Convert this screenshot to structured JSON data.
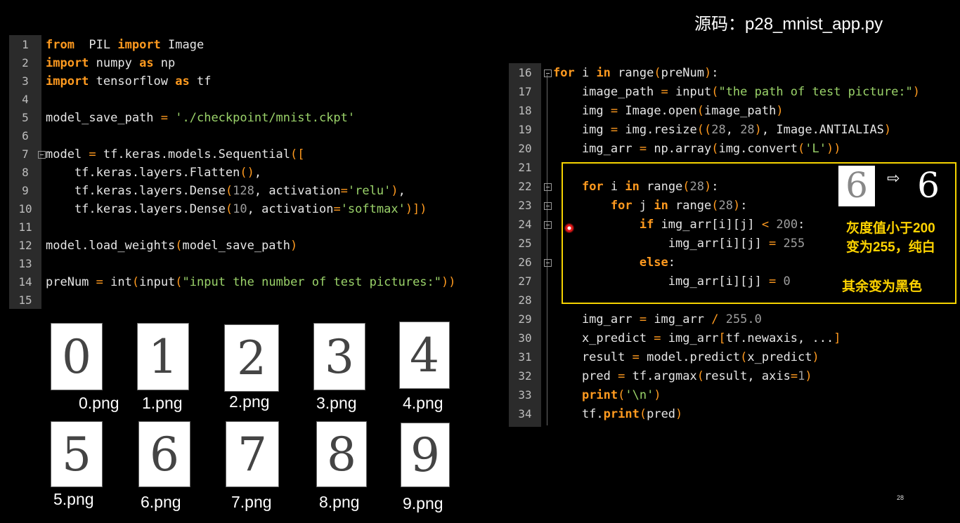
{
  "title": "源码：p28_mnist_app.py",
  "left_code": {
    "lines": [
      {
        "n": "1",
        "tokens": [
          [
            "kw",
            "from"
          ],
          [
            "",
            "  PIL "
          ],
          [
            "kw",
            "import"
          ],
          [
            "",
            " Image"
          ]
        ]
      },
      {
        "n": "2",
        "tokens": [
          [
            "kw",
            "import"
          ],
          [
            "",
            " numpy "
          ],
          [
            "kw",
            "as"
          ],
          [
            "",
            " np"
          ]
        ]
      },
      {
        "n": "3",
        "tokens": [
          [
            "kw",
            "import"
          ],
          [
            "",
            " tensorflow "
          ],
          [
            "kw",
            "as"
          ],
          [
            "",
            " tf"
          ]
        ]
      },
      {
        "n": "4",
        "tokens": []
      },
      {
        "n": "5",
        "tokens": [
          [
            "",
            "model_save_path "
          ],
          [
            "pu",
            "="
          ],
          [
            "",
            " "
          ],
          [
            "st",
            "'./checkpoint/mnist.ckpt'"
          ]
        ]
      },
      {
        "n": "6",
        "tokens": []
      },
      {
        "n": "7",
        "tokens": [
          [
            "",
            "model "
          ],
          [
            "pu",
            "="
          ],
          [
            "",
            " tf.keras.models.Sequential"
          ],
          [
            "pu",
            "(["
          ]
        ]
      },
      {
        "n": "8",
        "tokens": [
          [
            "",
            "    tf.keras.layers.Flatten"
          ],
          [
            "pu",
            "()"
          ],
          [
            "",
            ","
          ]
        ]
      },
      {
        "n": "9",
        "tokens": [
          [
            "",
            "    tf.keras.layers.Dense"
          ],
          [
            "pu",
            "("
          ],
          [
            "nu",
            "128"
          ],
          [
            "",
            ", activation"
          ],
          [
            "pu",
            "="
          ],
          [
            "st",
            "'relu'"
          ],
          [
            "pu",
            ")"
          ],
          [
            "",
            ","
          ]
        ]
      },
      {
        "n": "10",
        "tokens": [
          [
            "",
            "    tf.keras.layers.Dense"
          ],
          [
            "pu",
            "("
          ],
          [
            "nu",
            "10"
          ],
          [
            "",
            ", activation"
          ],
          [
            "pu",
            "="
          ],
          [
            "st",
            "'softmax'"
          ],
          [
            "pu",
            ")])"
          ]
        ]
      },
      {
        "n": "11",
        "tokens": []
      },
      {
        "n": "12",
        "tokens": [
          [
            "",
            "model.load_weights"
          ],
          [
            "pu",
            "("
          ],
          [
            "",
            "model_save_path"
          ],
          [
            "pu",
            ")"
          ]
        ]
      },
      {
        "n": "13",
        "tokens": []
      },
      {
        "n": "14",
        "tokens": [
          [
            "",
            "preNum "
          ],
          [
            "pu",
            "="
          ],
          [
            "",
            " int"
          ],
          [
            "pu",
            "("
          ],
          [
            "",
            "input"
          ],
          [
            "pu",
            "("
          ],
          [
            "st",
            "\"input the number of test pictures:\""
          ],
          [
            "pu",
            "))"
          ]
        ]
      },
      {
        "n": "15",
        "tokens": []
      }
    ]
  },
  "right_code": {
    "lines": [
      {
        "n": "16",
        "tokens": [
          [
            "kw",
            "for"
          ],
          [
            "",
            " i "
          ],
          [
            "kw",
            "in"
          ],
          [
            "",
            " range"
          ],
          [
            "pu",
            "("
          ],
          [
            "",
            "preNum"
          ],
          [
            "pu",
            ")"
          ],
          [
            "",
            ":"
          ]
        ]
      },
      {
        "n": "17",
        "tokens": [
          [
            "",
            "    image_path "
          ],
          [
            "pu",
            "="
          ],
          [
            "",
            " input"
          ],
          [
            "pu",
            "("
          ],
          [
            "st",
            "\"the path of test picture:\""
          ],
          [
            "pu",
            ")"
          ]
        ]
      },
      {
        "n": "18",
        "tokens": [
          [
            "",
            "    img "
          ],
          [
            "pu",
            "="
          ],
          [
            "",
            " Image.open"
          ],
          [
            "pu",
            "("
          ],
          [
            "",
            "image_path"
          ],
          [
            "pu",
            ")"
          ]
        ]
      },
      {
        "n": "19",
        "tokens": [
          [
            "",
            "    img "
          ],
          [
            "pu",
            "="
          ],
          [
            "",
            " img.resize"
          ],
          [
            "pu",
            "(("
          ],
          [
            "nu",
            "28"
          ],
          [
            "",
            ", "
          ],
          [
            "nu",
            "28"
          ],
          [
            "pu",
            ")"
          ],
          [
            "",
            ", Image.ANTIALIAS"
          ],
          [
            "pu",
            ")"
          ]
        ]
      },
      {
        "n": "20",
        "tokens": [
          [
            "",
            "    img_arr "
          ],
          [
            "pu",
            "="
          ],
          [
            "",
            " np.array"
          ],
          [
            "pu",
            "("
          ],
          [
            "",
            "img.convert"
          ],
          [
            "pu",
            "("
          ],
          [
            "st",
            "'L'"
          ],
          [
            "pu",
            "))"
          ]
        ]
      },
      {
        "n": "21",
        "tokens": []
      },
      {
        "n": "22",
        "tokens": [
          [
            "",
            "    "
          ],
          [
            "kw",
            "for"
          ],
          [
            "",
            " i "
          ],
          [
            "kw",
            "in"
          ],
          [
            "",
            " range"
          ],
          [
            "pu",
            "("
          ],
          [
            "nu",
            "28"
          ],
          [
            "pu",
            ")"
          ],
          [
            "",
            ":"
          ]
        ]
      },
      {
        "n": "23",
        "tokens": [
          [
            "",
            "        "
          ],
          [
            "kw",
            "for"
          ],
          [
            "",
            " j "
          ],
          [
            "kw",
            "in"
          ],
          [
            "",
            " range"
          ],
          [
            "pu",
            "("
          ],
          [
            "nu",
            "28"
          ],
          [
            "pu",
            ")"
          ],
          [
            "",
            ":"
          ]
        ]
      },
      {
        "n": "24",
        "tokens": [
          [
            "",
            "            "
          ],
          [
            "kw",
            "if"
          ],
          [
            "",
            " img_arr[i][j] "
          ],
          [
            "pu",
            "<"
          ],
          [
            "",
            " "
          ],
          [
            "nu",
            "200"
          ],
          [
            "",
            ":"
          ]
        ]
      },
      {
        "n": "25",
        "tokens": [
          [
            "",
            "                img_arr[i][j] "
          ],
          [
            "pu",
            "="
          ],
          [
            "",
            " "
          ],
          [
            "nu",
            "255"
          ]
        ]
      },
      {
        "n": "26",
        "tokens": [
          [
            "",
            "            "
          ],
          [
            "kw",
            "else"
          ],
          [
            "",
            ":"
          ]
        ]
      },
      {
        "n": "27",
        "tokens": [
          [
            "",
            "                img_arr[i][j] "
          ],
          [
            "pu",
            "="
          ],
          [
            "",
            " "
          ],
          [
            "nu",
            "0"
          ]
        ]
      },
      {
        "n": "28",
        "tokens": []
      },
      {
        "n": "29",
        "tokens": [
          [
            "",
            "    img_arr "
          ],
          [
            "pu",
            "="
          ],
          [
            "",
            " img_arr "
          ],
          [
            "pu",
            "/"
          ],
          [
            "",
            " "
          ],
          [
            "nu",
            "255.0"
          ]
        ]
      },
      {
        "n": "30",
        "tokens": [
          [
            "",
            "    x_predict "
          ],
          [
            "pu",
            "="
          ],
          [
            "",
            " img_arr"
          ],
          [
            "pu",
            "["
          ],
          [
            "",
            "tf.newaxis, ..."
          ],
          [
            "pu",
            "]"
          ]
        ]
      },
      {
        "n": "31",
        "tokens": [
          [
            "",
            "    result "
          ],
          [
            "pu",
            "="
          ],
          [
            "",
            " model.predict"
          ],
          [
            "pu",
            "("
          ],
          [
            "",
            "x_predict"
          ],
          [
            "pu",
            ")"
          ]
        ]
      },
      {
        "n": "32",
        "tokens": [
          [
            "",
            "    pred "
          ],
          [
            "pu",
            "="
          ],
          [
            "",
            " tf.argmax"
          ],
          [
            "pu",
            "("
          ],
          [
            "",
            "result, axis"
          ],
          [
            "pu",
            "="
          ],
          [
            "nu",
            "1"
          ],
          [
            "pu",
            ")"
          ]
        ]
      },
      {
        "n": "33",
        "tokens": [
          [
            "",
            "    "
          ],
          [
            "kw",
            "print"
          ],
          [
            "pu",
            "("
          ],
          [
            "st",
            "'\\n'"
          ],
          [
            "pu",
            ")"
          ]
        ]
      },
      {
        "n": "34",
        "tokens": [
          [
            "",
            "    tf."
          ],
          [
            "kw",
            "print"
          ],
          [
            "pu",
            "("
          ],
          [
            "",
            "pred"
          ],
          [
            "pu",
            ")"
          ]
        ]
      }
    ]
  },
  "annotation": {
    "line1": "灰度值小于200",
    "line2": "变为255，纯白",
    "line3": "其余变为黑色",
    "arrow": "⇨",
    "digit_before": "6",
    "digit_after": "6"
  },
  "digits": [
    {
      "glyph": "0",
      "caption": "0.png"
    },
    {
      "glyph": "1",
      "caption": "1.png"
    },
    {
      "glyph": "2",
      "caption": "2.png"
    },
    {
      "glyph": "3",
      "caption": "3.png"
    },
    {
      "glyph": "4",
      "caption": "4.png"
    },
    {
      "glyph": "5",
      "caption": "5.png"
    },
    {
      "glyph": "6",
      "caption": "6.png"
    },
    {
      "glyph": "7",
      "caption": "7.png"
    },
    {
      "glyph": "8",
      "caption": "8.png"
    },
    {
      "glyph": "9",
      "caption": "9.png"
    }
  ],
  "page_number": "28"
}
